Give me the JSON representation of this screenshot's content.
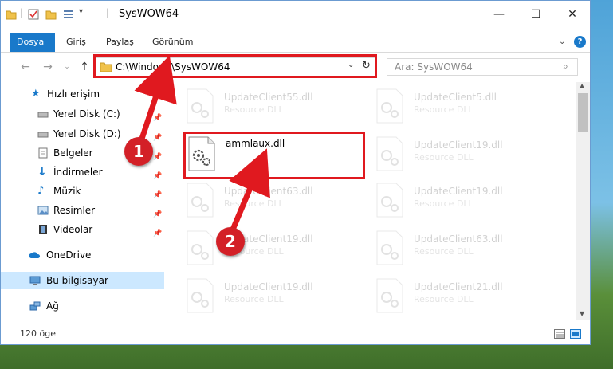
{
  "window": {
    "title": "SysWOW64",
    "minimize": "—",
    "maximize": "☐",
    "close": "✕"
  },
  "ribbon": {
    "tabs": [
      {
        "label": "Dosya"
      },
      {
        "label": "Giriş"
      },
      {
        "label": "Paylaş"
      },
      {
        "label": "Görünüm"
      }
    ],
    "help": "?"
  },
  "address": {
    "path": "C:\\Windows\\SysWOW64",
    "search_placeholder": "Ara: SysWOW64"
  },
  "sidebar": {
    "items": [
      {
        "label": "Hızlı erişim"
      },
      {
        "label": "Yerel Disk (C:)"
      },
      {
        "label": "Yerel Disk (D:)"
      },
      {
        "label": "Belgeler"
      },
      {
        "label": "İndirmeler"
      },
      {
        "label": "Müzik"
      },
      {
        "label": "Resimler"
      },
      {
        "label": "Videolar"
      },
      {
        "label": "OneDrive"
      },
      {
        "label": "Bu bilgisayar"
      },
      {
        "label": "Ağ"
      }
    ]
  },
  "files": [
    {
      "name": "UpdateClient55.dll",
      "type": "Resource DLL"
    },
    {
      "name": "UpdateClient5.dll",
      "type": "Resource DLL"
    },
    {
      "name": "ammlaux.dll",
      "type": ""
    },
    {
      "name": "UpdateClient19.dll",
      "type": "Resource DLL"
    },
    {
      "name": "UpdateClient63.dll",
      "type": "Resource DLL"
    },
    {
      "name": "UpdateClient19.dll",
      "type": "Resource DLL"
    },
    {
      "name": "UpdateClient19.dll",
      "type": "Resource DLL"
    },
    {
      "name": "UpdateClient63.dll",
      "type": "Resource DLL"
    },
    {
      "name": "UpdateClient19.dll",
      "type": "Resource DLL"
    },
    {
      "name": "UpdateClient21.dll",
      "type": "Resource DLL"
    }
  ],
  "status": {
    "count": "120 öge"
  },
  "annotations": {
    "step1": "1",
    "step2": "2"
  },
  "colors": {
    "accent": "#1979ca",
    "highlight": "#e0191f",
    "callout": "#d32027"
  }
}
